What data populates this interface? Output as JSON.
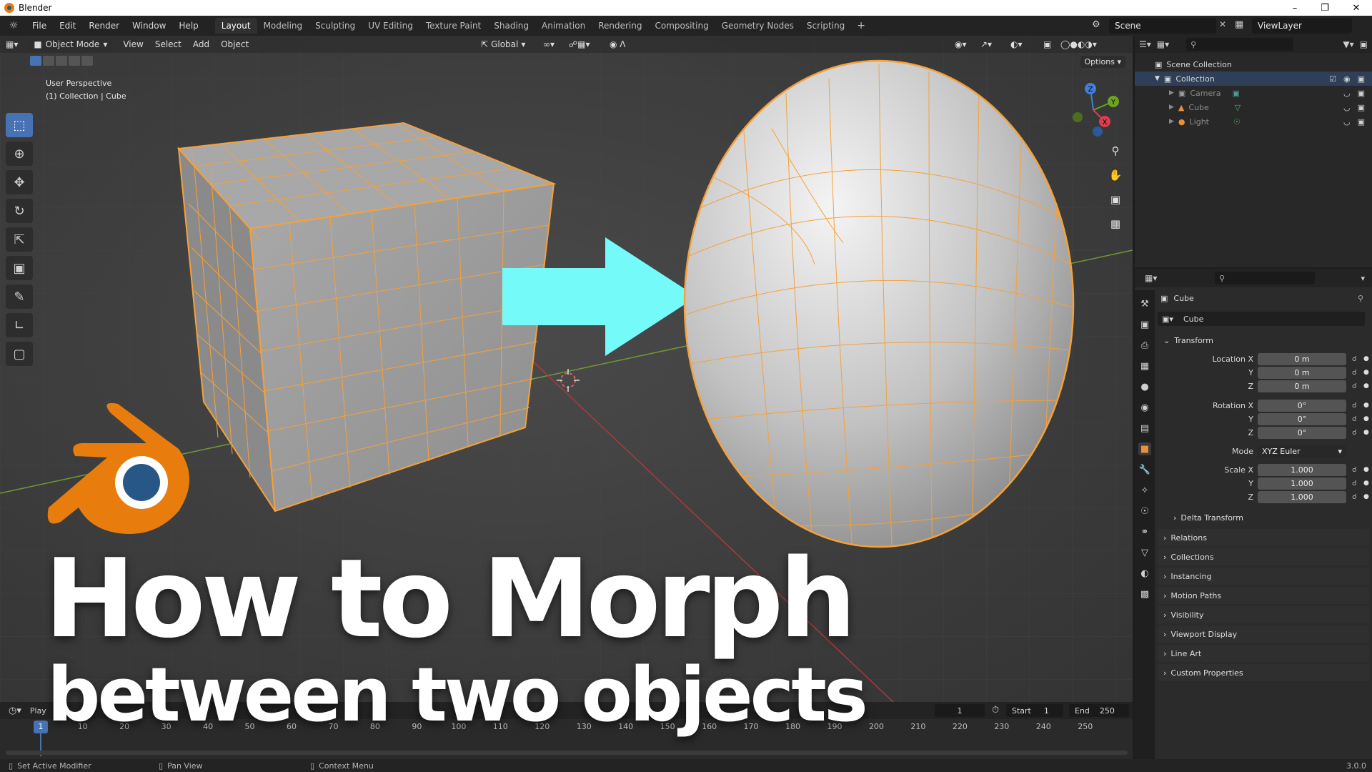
{
  "window": {
    "title": "Blender"
  },
  "menu": {
    "items": [
      "File",
      "Edit",
      "Render",
      "Window",
      "Help"
    ]
  },
  "workspaces": {
    "tabs": [
      "Layout",
      "Modeling",
      "Sculpting",
      "UV Editing",
      "Texture Paint",
      "Shading",
      "Animation",
      "Rendering",
      "Compositing",
      "Geometry Nodes",
      "Scripting"
    ],
    "active": "Layout",
    "add": "+"
  },
  "scene": {
    "name": "Scene",
    "view_layer": "ViewLayer"
  },
  "viewport": {
    "mode": "Object Mode",
    "menus": [
      "View",
      "Select",
      "Add",
      "Object"
    ],
    "orientation": "Global",
    "options": "Options",
    "info_line1": "User Perspective",
    "info_line2": "(1) Collection | Cube",
    "gizmo": {
      "x": "X",
      "y": "Y",
      "z": "Z"
    }
  },
  "overlay": {
    "headline": "How to Morph",
    "subline": "between two objects"
  },
  "timeline": {
    "playback": "Play",
    "current_frame": "1",
    "start_label": "Start",
    "start": "1",
    "end_label": "End",
    "end": "250",
    "ticks": [
      "10",
      "20",
      "30",
      "40",
      "50",
      "60",
      "70",
      "80",
      "90",
      "100",
      "110",
      "120",
      "130",
      "140",
      "150",
      "160",
      "170",
      "180",
      "190",
      "200",
      "210",
      "220",
      "230",
      "240",
      "250"
    ],
    "cursor": "1"
  },
  "status": {
    "left": "Set Active Modifier",
    "middle": "Pan View",
    "right": "Context Menu",
    "version": "3.0.0"
  },
  "outliner": {
    "root": "Scene Collection",
    "collection": "Collection",
    "items": [
      "Camera",
      "Cube",
      "Light"
    ]
  },
  "properties": {
    "object_name": "Cube",
    "data_name": "Cube",
    "transform": "Transform",
    "location_x_label": "Location X",
    "y_label": "Y",
    "z_label": "Z",
    "location": [
      "0 m",
      "0 m",
      "0 m"
    ],
    "rotation_x_label": "Rotation X",
    "rotation": [
      "0°",
      "0°",
      "0°"
    ],
    "mode_label": "Mode",
    "mode": "XYZ Euler",
    "scale_x_label": "Scale X",
    "scale": [
      "1.000",
      "1.000",
      "1.000"
    ],
    "delta": "Delta Transform",
    "panels": [
      "Relations",
      "Collections",
      "Instancing",
      "Motion Paths",
      "Visibility",
      "Viewport Display",
      "Line Art",
      "Custom Properties"
    ]
  },
  "colors": {
    "accent": "#4772b3",
    "selection": "#f5a13a",
    "arrow": "#75fafa",
    "blender_orange": "#e87d0d",
    "blender_blue": "#265787"
  }
}
